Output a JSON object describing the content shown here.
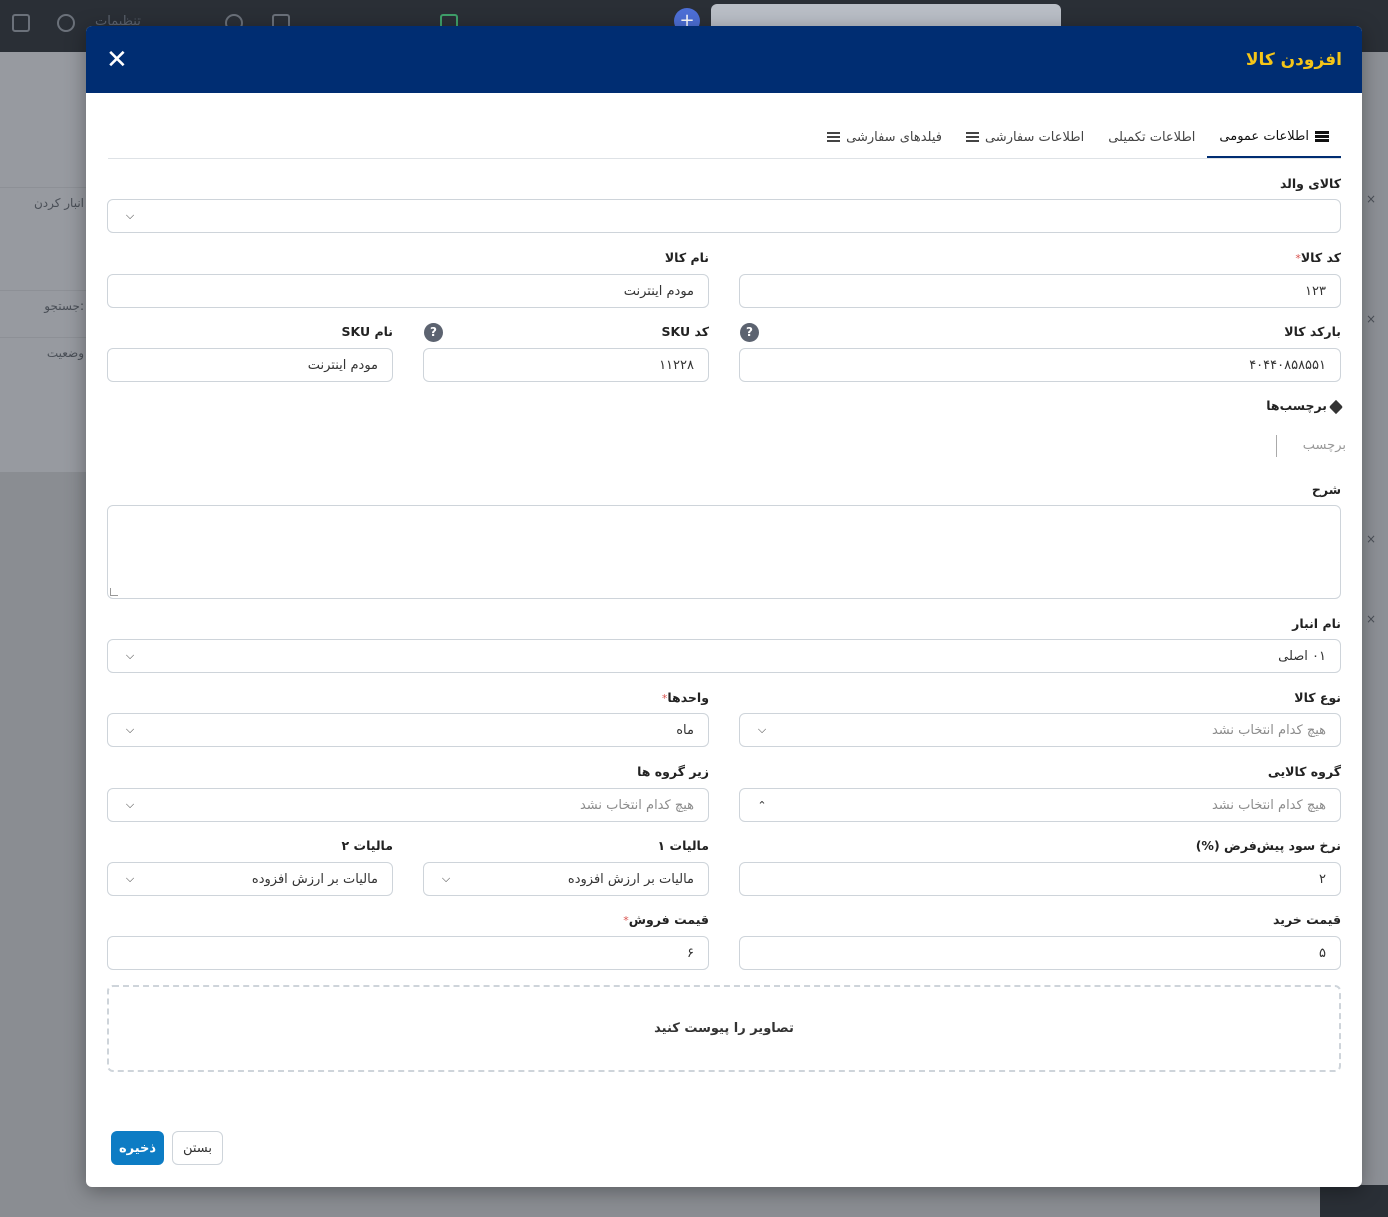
{
  "background": {
    "settings_label": "تنظیمات",
    "search_placeholder": "جستجو",
    "left_rows": [
      "انبار کردن",
      "جستجو:",
      "وضعیت"
    ]
  },
  "modal": {
    "title": "افزودن کالا",
    "close_icon": "close-icon"
  },
  "tabs": [
    {
      "label": "اطلاعات عمومی",
      "icon": "database-icon",
      "active": true
    },
    {
      "label": "اطلاعات تکمیلی",
      "icon": "",
      "active": false
    },
    {
      "label": "اطلاعات سفارشی",
      "icon": "list-icon",
      "active": false
    },
    {
      "label": "فیلدهای سفارشی",
      "icon": "list-icon",
      "active": false
    }
  ],
  "form": {
    "parent_item": {
      "label": "کالای والد",
      "value": ""
    },
    "item_code": {
      "label": "کد کالا",
      "value": "۱۲۳",
      "required": true
    },
    "item_name": {
      "label": "نام کالا",
      "value": "مودم اینترنت"
    },
    "barcode": {
      "label": "بارکد کالا",
      "value": "۴۰۴۴۰۸۵۸۵۵۱"
    },
    "sku_code": {
      "label": "کد SKU",
      "value": "۱۱۲۲۸"
    },
    "sku_name": {
      "label": "نام SKU",
      "value": "مودم اینترنت"
    },
    "tags": {
      "label": "برچسب‌ها",
      "placeholder": "برچسب"
    },
    "description": {
      "label": "شرح",
      "value": ""
    },
    "warehouse": {
      "label": "نام انبار",
      "value": "۰۱ اصلی"
    },
    "item_type": {
      "label": "نوع کالا",
      "placeholder": "هیچ کدام انتخاب نشد"
    },
    "units": {
      "label": "واحدها",
      "value": "ماه",
      "required": true
    },
    "item_group": {
      "label": "گروه کالایی",
      "placeholder": "هیچ کدام انتخاب نشد"
    },
    "subgroups": {
      "label": "زیر گروه ها",
      "placeholder": "هیچ کدام انتخاب نشد"
    },
    "default_profit": {
      "label": "نرخ سود پیش‌فرض (%)",
      "value": "۲"
    },
    "tax1": {
      "label": "مالیات ۱",
      "value": "مالیات بر ارزش افزوده"
    },
    "tax2": {
      "label": "مالیات ۲",
      "value": "مالیات بر ارزش افزوده"
    },
    "purchase_price": {
      "label": "قیمت خرید",
      "value": "۵"
    },
    "sale_price": {
      "label": "قیمت فروش",
      "value": "۶",
      "required": true
    },
    "images_dropzone": "تصاویر را پیوست کنید",
    "required_mark": "*"
  },
  "footer": {
    "save_label": "ذخیره",
    "close_label": "بستن"
  },
  "colors": {
    "header_bg": "#002d72",
    "title_color": "#f5c518",
    "save_bg": "#0d7cc4"
  }
}
